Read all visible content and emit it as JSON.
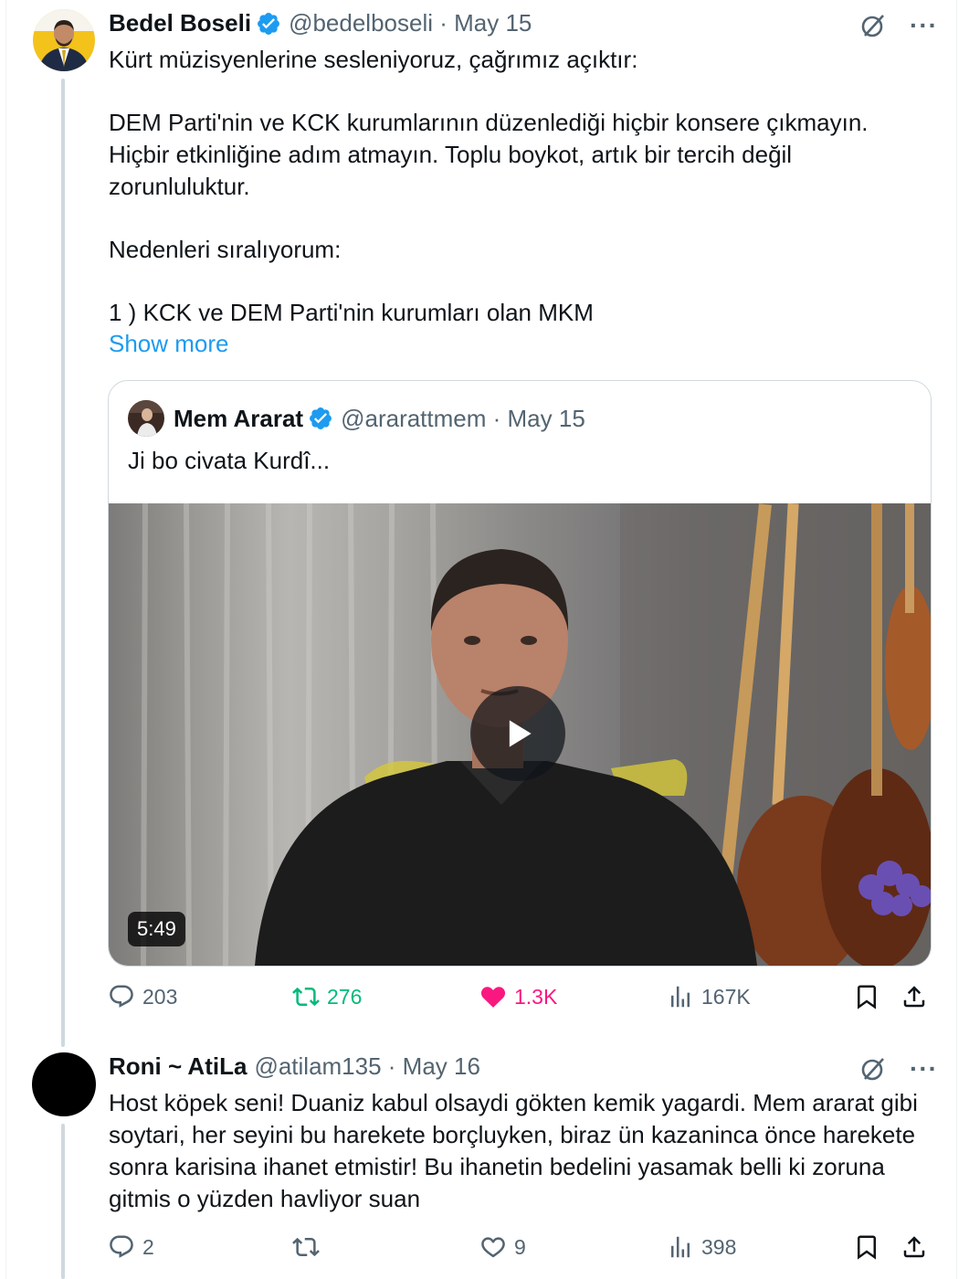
{
  "colors": {
    "accent": "#1d9bf0",
    "retweet": "#00ba7c",
    "like": "#f91880",
    "muted": "#536471",
    "text": "#0f1419"
  },
  "tweet": {
    "name": "Bedel Boseli",
    "handle_date": "@bedelboseli · May 15",
    "paragraphs": [
      "Kürt müzisyenlerine sesleniyoruz, çağrımız açıktır:",
      "DEM Parti'nin ve KCK kurumlarının düzenlediği hiçbir konsere çıkmayın. Hiçbir etkinliğine adım atmayın. Toplu boykot, artık bir tercih değil zorunluluktur.",
      "Nedenleri sıralıyorum:",
      "1 ) KCK ve DEM Parti'nin kurumları olan MKM"
    ],
    "show_more": "Show more",
    "quote": {
      "name": "Mem Ararat",
      "handle_date": "@ararattmem · May 15",
      "text": "Ji bo civata Kurdî...",
      "video_duration": "5:49"
    },
    "actions": {
      "replies": "203",
      "reposts": "276",
      "likes": "1.3K",
      "views": "167K"
    }
  },
  "reply": {
    "name": "Roni ~ AtiLa",
    "handle_date": "@atilam135 · May 16",
    "text": "Host köpek seni! Duaniz kabul olsaydi gökten kemik yagardi. Mem ararat gibi soytari, her seyini bu harekete borçluyken, biraz ün kazaninca önce harekete sonra karisina ihanet etmistir! Bu ihanetin bedelini yasamak belli ki zoruna gitmis o yüzden havliyor suan",
    "actions": {
      "replies": "2",
      "reposts": "",
      "likes": "9",
      "views": "398"
    }
  }
}
